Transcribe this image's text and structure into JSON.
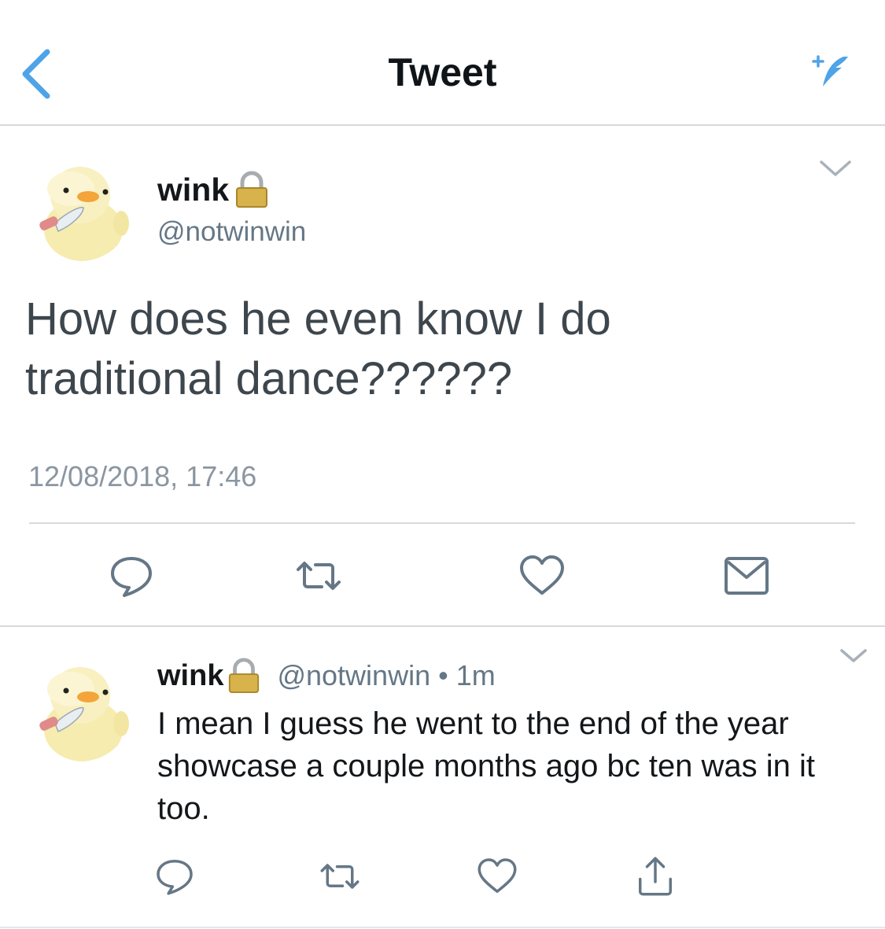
{
  "header": {
    "title": "Tweet",
    "back_icon": "chevron-left-icon",
    "compose_icon": "compose-tweet-icon",
    "accent_color": "#1da1f2"
  },
  "main_tweet": {
    "display_name": "wink",
    "protected_icon": "lock-icon",
    "handle": "@notwinwin",
    "text": "How does he even know I do traditional dance??????",
    "timestamp": "12/08/2018, 17:46",
    "actions": [
      "reply-icon",
      "retweet-icon",
      "like-icon",
      "direct-message-icon"
    ]
  },
  "reply_tweet": {
    "display_name": "wink",
    "protected_icon": "lock-icon",
    "handle": "@notwinwin",
    "separator": "•",
    "relative_time": "1m",
    "text": "I mean I guess he went to the end of the year showcase a couple months ago bc ten was in it too.",
    "actions": [
      "reply-icon",
      "retweet-icon",
      "like-icon",
      "share-icon"
    ]
  }
}
